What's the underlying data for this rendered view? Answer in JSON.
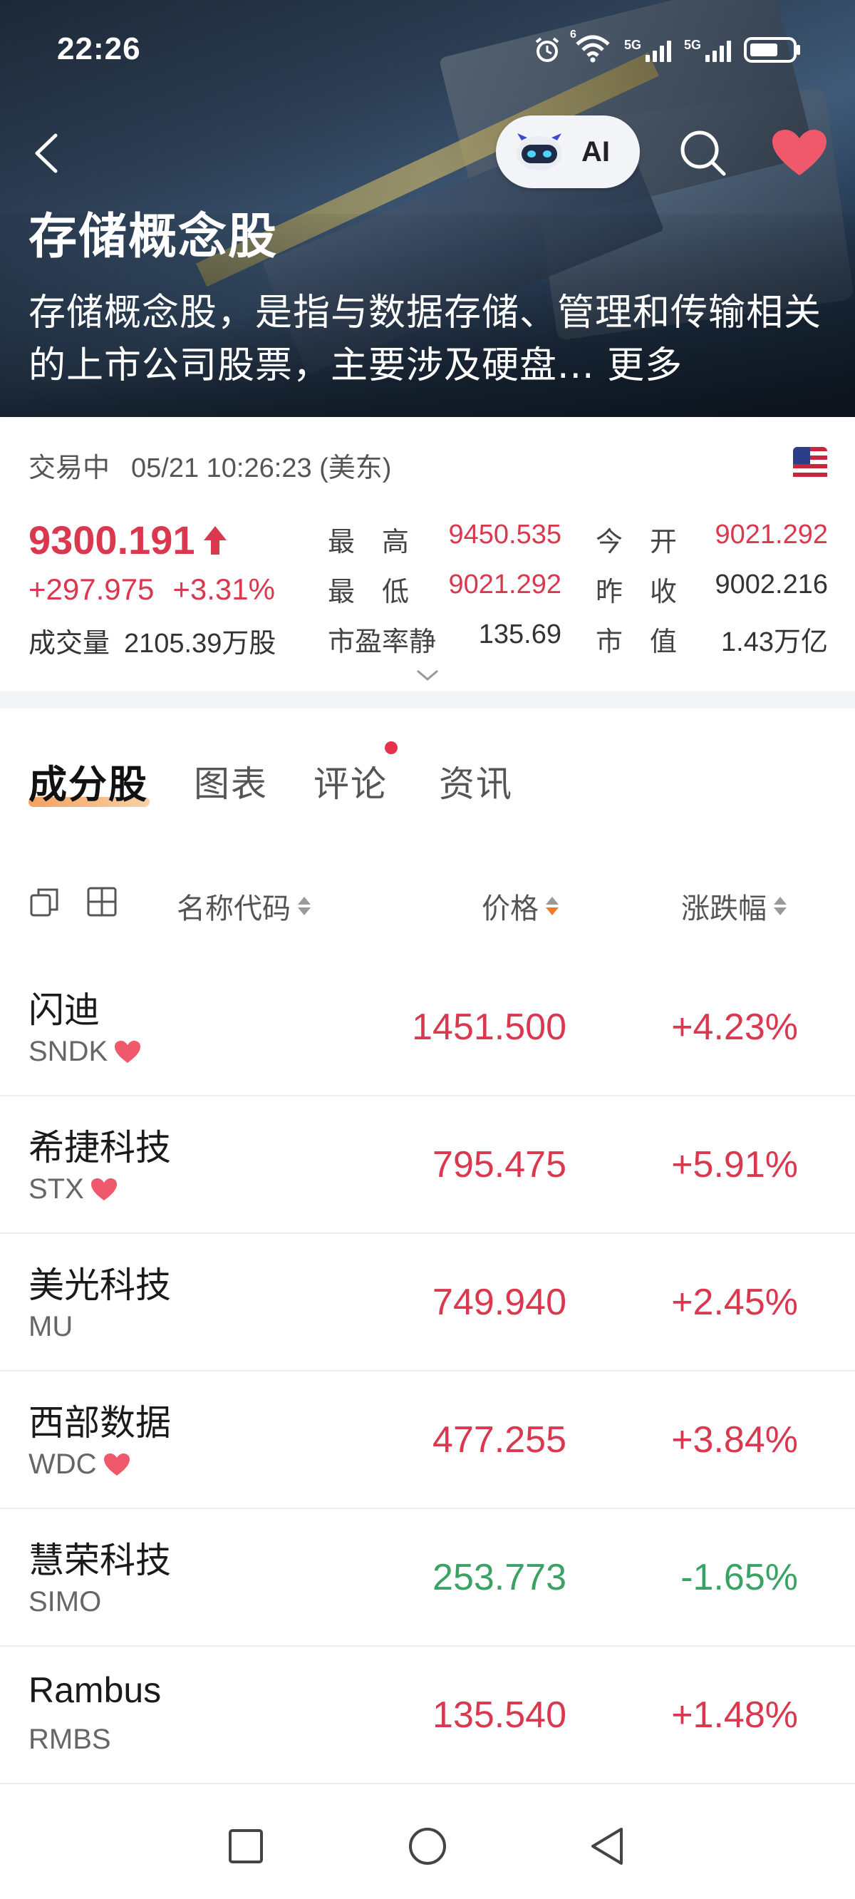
{
  "status_bar": {
    "time": "22:26",
    "wifi_badge": "6",
    "sim1": "5G",
    "sim2": "5G"
  },
  "topbar": {
    "ai_label": "AI"
  },
  "hero": {
    "title": "存储概念股",
    "description": "存储概念股，是指与数据存储、管理和传输相关的上市公司股票，主要涉及硬盘...",
    "more": "更多"
  },
  "quote": {
    "status": "交易中",
    "datetime": "05/21 10:26:23 (美东)",
    "price": "9300.191",
    "change": "+297.975",
    "change_pct": "+3.31%",
    "volume_label": "成交量",
    "volume": "2105.39万股",
    "high_label": "最　高",
    "high": "9450.535",
    "open_label": "今　开",
    "open": "9021.292",
    "low_label": "最　低",
    "low": "9021.292",
    "prev_close_label": "昨　收",
    "prev_close": "9002.216",
    "pe_label": "市盈率静",
    "pe": "135.69",
    "mcap_label": "市　值",
    "mcap": "1.43万亿",
    "colors": {
      "up": "#d9384f",
      "down": "#3aa264"
    }
  },
  "tabs": [
    {
      "label": "成分股",
      "active": true
    },
    {
      "label": "图表",
      "active": false
    },
    {
      "label": "评论",
      "active": false,
      "badge_dot": true
    },
    {
      "label": "资讯",
      "active": false
    }
  ],
  "table": {
    "headers": {
      "name": "名称代码",
      "price": "价格",
      "change": "涨跌幅"
    },
    "rows": [
      {
        "name": "闪迪",
        "code": "SNDK",
        "favorite": true,
        "price": "1451.500",
        "pct": "+4.23%",
        "dir": "up"
      },
      {
        "name": "希捷科技",
        "code": "STX",
        "favorite": true,
        "price": "795.475",
        "pct": "+5.91%",
        "dir": "up"
      },
      {
        "name": "美光科技",
        "code": "MU",
        "favorite": false,
        "price": "749.940",
        "pct": "+2.45%",
        "dir": "up"
      },
      {
        "name": "西部数据",
        "code": "WDC",
        "favorite": true,
        "price": "477.255",
        "pct": "+3.84%",
        "dir": "up"
      },
      {
        "name": "慧荣科技",
        "code": "SIMO",
        "favorite": false,
        "price": "253.773",
        "pct": "-1.65%",
        "dir": "down"
      },
      {
        "name": "Rambus",
        "code": "RMBS",
        "favorite": false,
        "price": "135.540",
        "pct": "+1.48%",
        "dir": "up"
      }
    ]
  },
  "icons": {
    "back": "back-arrow-icon",
    "robot": "robot-icon",
    "search": "search-icon",
    "favorite": "heart-icon",
    "flag": "us-flag-icon",
    "nav_recents": "square-icon",
    "nav_home": "circle-icon",
    "nav_back": "triangle-icon"
  }
}
